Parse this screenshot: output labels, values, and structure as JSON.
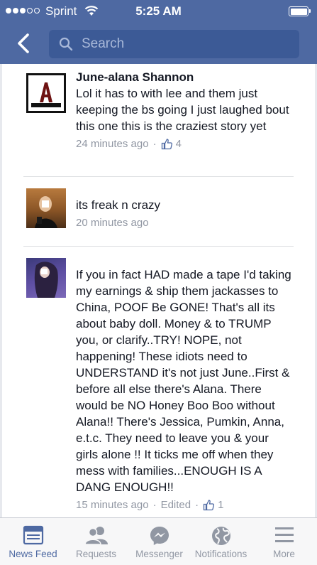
{
  "status_bar": {
    "carrier": "Sprint",
    "time": "5:25 AM",
    "signal_bars_filled": 3,
    "signal_bars_total": 5,
    "battery_level": 1.0
  },
  "nav": {
    "search_placeholder": "Search"
  },
  "comments": [
    {
      "name": "June-alana Shannon",
      "text": "Lol it has to with lee and them just keeping the bs going I just laughed bout this one this is the craziest story yet",
      "time": "24 minutes ago",
      "separator": "·",
      "likes": "4"
    },
    {
      "name": "",
      "text": "its freak n crazy",
      "time": "20 minutes ago"
    },
    {
      "name": "",
      "text": "If you in fact HAD made a tape I'd taking my earnings & ship them jackasses to China, POOF Be GONE! That's all its about baby doll. Money & to TRUMP you, or clarify..TRY! NOPE, not happening! These idiots need to UNDERSTAND it's not just June..First & before all else there's Alana. There would be NO Honey Boo Boo without Alana!! There's Jessica, Pumkin, Anna, e.t.c. They need to leave you & your girls alone !! It ticks me off when they mess with families...ENOUGH IS A DANG ENOUGH!!",
      "time": "15 minutes ago",
      "edited": "Edited",
      "likes": "1"
    }
  ],
  "tabs": [
    {
      "label": "News Feed",
      "icon": "news-feed-icon",
      "active": true
    },
    {
      "label": "Requests",
      "icon": "friend-requests-icon",
      "active": false
    },
    {
      "label": "Messenger",
      "icon": "messenger-icon",
      "active": false
    },
    {
      "label": "Notifications",
      "icon": "globe-icon",
      "active": false
    },
    {
      "label": "More",
      "icon": "menu-icon",
      "active": false
    }
  ],
  "colors": {
    "brand": "#4e69a2",
    "search_field": "#3c5a96",
    "meta_text": "#9197a3",
    "body_text": "#141823"
  }
}
